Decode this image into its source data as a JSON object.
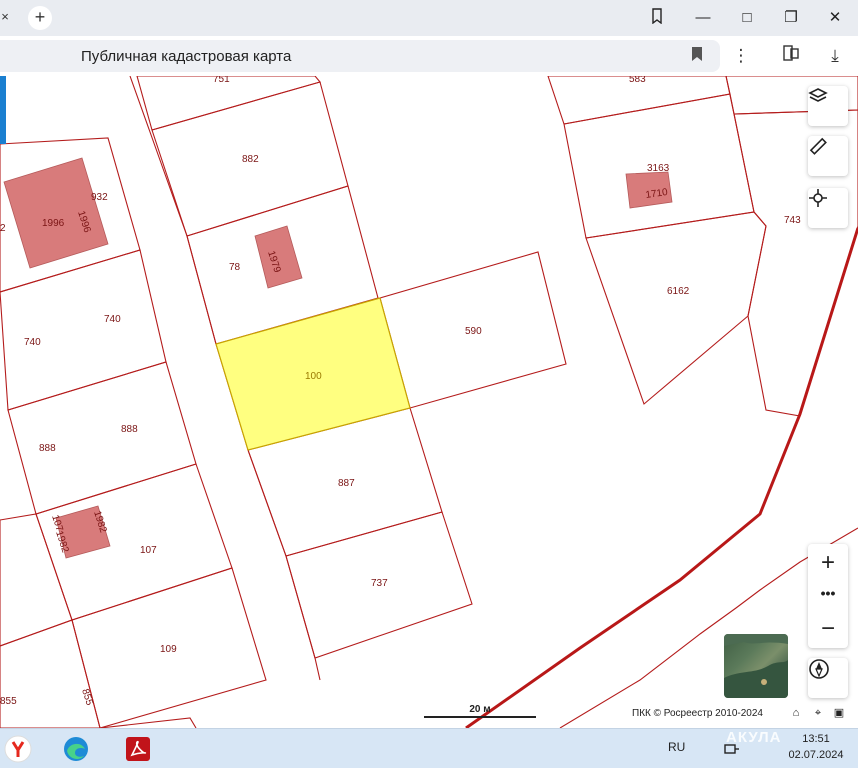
{
  "browser": {
    "page_title": "Публичная кадастровая карта"
  },
  "map": {
    "selected_parcel": "100",
    "parcel_labels": [
      "751",
      "882",
      "78",
      "590",
      "887",
      "737",
      "932",
      "740",
      "740",
      "888",
      "888",
      "107",
      "107",
      "109",
      "855",
      "855",
      "583",
      "3163",
      "743",
      "6162",
      "2"
    ],
    "building_labels": [
      "1996",
      "1996",
      "1979",
      "1982",
      "1982",
      "1710"
    ],
    "scale_label": "20 м",
    "copyright": "ПКК © Росреестр 2010-2024"
  },
  "taskbar": {
    "language": "RU",
    "time": "13:51",
    "date": "02.07.2024",
    "watermark": "АКУЛА"
  },
  "colors": {
    "parcel_border": "#b41c1c",
    "selected_fill": "#ffff80",
    "building_fill": "#d87b7b",
    "boundary_line": "#b81818"
  },
  "icons": {
    "layers": "layers-icon",
    "ruler": "ruler-icon",
    "locate": "crosshair-icon",
    "zoom_in": "plus-icon",
    "zoom_out": "minus-icon",
    "compass": "compass-icon"
  }
}
